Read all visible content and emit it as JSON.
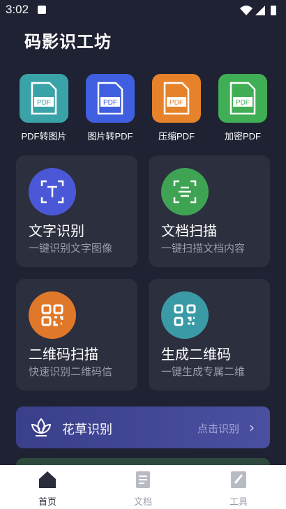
{
  "status": {
    "time": "3:02"
  },
  "app": {
    "title": "码影识工坊"
  },
  "tools": [
    {
      "label": "PDF转图片",
      "badge": "PDF",
      "color": "#3aa3a8",
      "icon": "pdf-to-image-icon"
    },
    {
      "label": "图片转PDF",
      "badge": "PDF",
      "color": "#3f5fe0",
      "icon": "image-to-pdf-icon"
    },
    {
      "label": "压缩PDF",
      "badge": "PDF",
      "color": "#e5822a",
      "icon": "compress-pdf-icon"
    },
    {
      "label": "加密PDF",
      "badge": "PDF",
      "color": "#3fae55",
      "icon": "encrypt-pdf-icon"
    }
  ],
  "cards": [
    {
      "title": "文字识别",
      "subtitle": "一键识别文字图像",
      "color": "#4a58d8",
      "icon": "text-recognition-icon"
    },
    {
      "title": "文档扫描",
      "subtitle": "一键扫描文档内容",
      "color": "#3fa354",
      "icon": "document-scan-icon"
    },
    {
      "title": "二维码扫描",
      "subtitle": "快速识别二维码信",
      "color": "#e0782a",
      "icon": "qr-scan-icon"
    },
    {
      "title": "生成二维码",
      "subtitle": "一键生成专属二维",
      "color": "#3a9aa6",
      "icon": "qr-generate-icon"
    }
  ],
  "banner": {
    "title": "花草识别",
    "action": "点击识别",
    "chevron": "›",
    "icon": "lotus-icon"
  },
  "nav": [
    {
      "label": "首页",
      "icon": "home-icon",
      "active": true
    },
    {
      "label": "文档",
      "icon": "document-icon",
      "active": false
    },
    {
      "label": "工具",
      "icon": "tools-icon",
      "active": false
    }
  ],
  "colors": {
    "background": "#1f2233",
    "card": "#2c2f3d",
    "nav_active": "#2b2d3a",
    "nav_inactive": "#9a9ca8"
  }
}
